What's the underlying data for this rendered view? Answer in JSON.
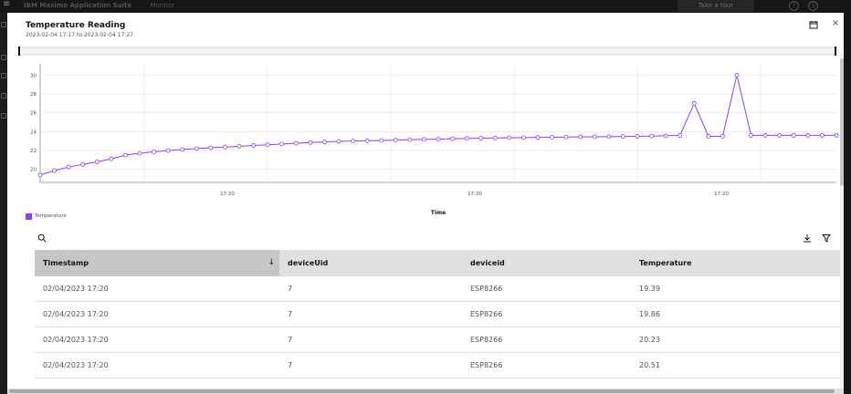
{
  "shell": {
    "app_title": "IBM Maximo Application Suite",
    "app_sub": "Monitor",
    "tour_label": "Take a tour",
    "help_icon_label": "?",
    "user_icon_label": "Ⓢ"
  },
  "modal": {
    "title": "Temperature Reading",
    "subtitle": "2023-02-04 17:17 to 2023-02-04 17:27",
    "close_label": "×"
  },
  "legend": {
    "label": "Temperature",
    "color": "#8a3ffc"
  },
  "chart_data": {
    "type": "line",
    "xlabel": "Time",
    "ylabel": "",
    "x_tick_labels": [
      "17:20",
      "17:20",
      "17:20"
    ],
    "y_ticks": [
      20,
      22,
      24,
      26,
      28,
      30
    ],
    "ylim": [
      18.6,
      31.2
    ],
    "grid": true,
    "legend_position": "bottom-left",
    "series": [
      {
        "name": "Temperature",
        "color": "#8a3ffc",
        "values": [
          19.39,
          19.86,
          20.23,
          20.51,
          20.78,
          21.1,
          21.5,
          21.7,
          21.85,
          21.98,
          22.1,
          22.2,
          22.28,
          22.35,
          22.44,
          22.52,
          22.6,
          22.68,
          22.76,
          22.84,
          22.9,
          22.96,
          23.0,
          23.03,
          23.06,
          23.1,
          23.14,
          23.17,
          23.2,
          23.24,
          23.27,
          23.3,
          23.32,
          23.34,
          23.36,
          23.38,
          23.4,
          23.42,
          23.44,
          23.45,
          23.46,
          23.48,
          23.5,
          23.52,
          23.55,
          23.6,
          27.0,
          23.5,
          23.5,
          30.0,
          23.6,
          23.6,
          23.6,
          23.6,
          23.6,
          23.6,
          23.6
        ]
      }
    ]
  },
  "table": {
    "columns": [
      "Timestamp",
      "deviceUid",
      "deviceid",
      "Temperature"
    ],
    "sort_icon": "↓",
    "rows": [
      [
        "02/04/2023 17:20",
        "7",
        "ESP8266",
        "19.39"
      ],
      [
        "02/04/2023 17:20",
        "7",
        "ESP8266",
        "19.86"
      ],
      [
        "02/04/2023 17:20",
        "7",
        "ESP8266",
        "20.23"
      ],
      [
        "02/04/2023 17:20",
        "7",
        "ESP8266",
        "20.51"
      ]
    ]
  }
}
